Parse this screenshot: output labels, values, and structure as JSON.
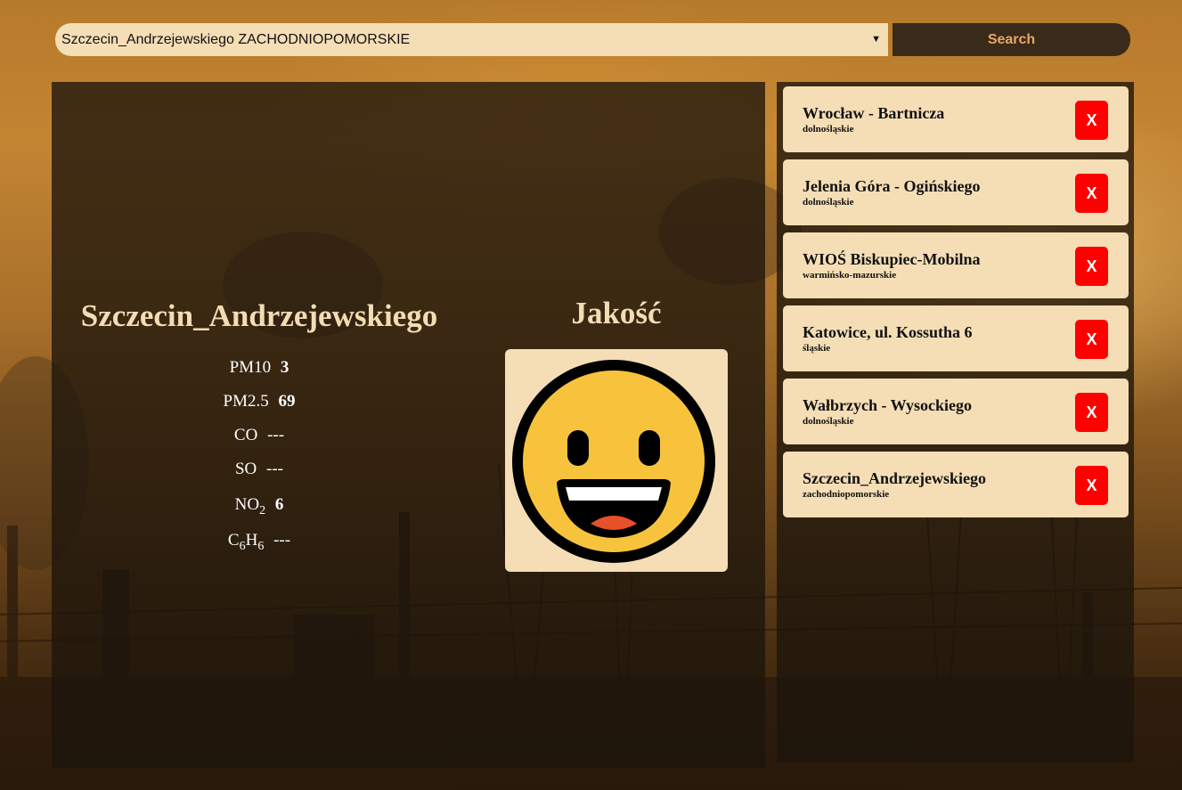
{
  "search": {
    "selected": "Szczecin_Andrzejewskiego ZACHODNIOPOMORSKIE",
    "button_label": "Search"
  },
  "station": {
    "name": "Szczecin_Andrzejewskiego",
    "readings": [
      {
        "label": "PM10",
        "value": "3"
      },
      {
        "label": "PM2.5",
        "value": "69"
      },
      {
        "label": "CO",
        "value": "---"
      },
      {
        "label": "SO",
        "value": "---"
      },
      {
        "label": "NO",
        "sub": "2",
        "value": "6"
      },
      {
        "label": "C",
        "sub": "6",
        "label2": "H",
        "sub2": "6",
        "value": "---"
      }
    ]
  },
  "quality": {
    "title": "Jakość",
    "icon": "smiley-face-icon"
  },
  "favorites": [
    {
      "name": "Wrocław - Bartnicza",
      "region": "dolnośląskie",
      "remove_label": "X"
    },
    {
      "name": "Jelenia Góra - Ogińskiego",
      "region": "dolnośląskie",
      "remove_label": "X"
    },
    {
      "name": "WIOŚ Biskupiec-Mobilna",
      "region": "warmińsko-mazurskie",
      "remove_label": "X"
    },
    {
      "name": "Katowice, ul. Kossutha 6",
      "region": "śląskie",
      "remove_label": "X"
    },
    {
      "name": "Wałbrzych - Wysockiego",
      "region": "dolnośląskie",
      "remove_label": "X"
    },
    {
      "name": "Szczecin_Andrzejewskiego",
      "region": "zachodniopomorskie",
      "remove_label": "X"
    }
  ],
  "colors": {
    "panel_bg": "#1c140c",
    "card_bg": "#f5deb6",
    "remove_button": "#ff0000",
    "search_button_text": "#e8a766",
    "heading_text": "#f3dcb4"
  }
}
